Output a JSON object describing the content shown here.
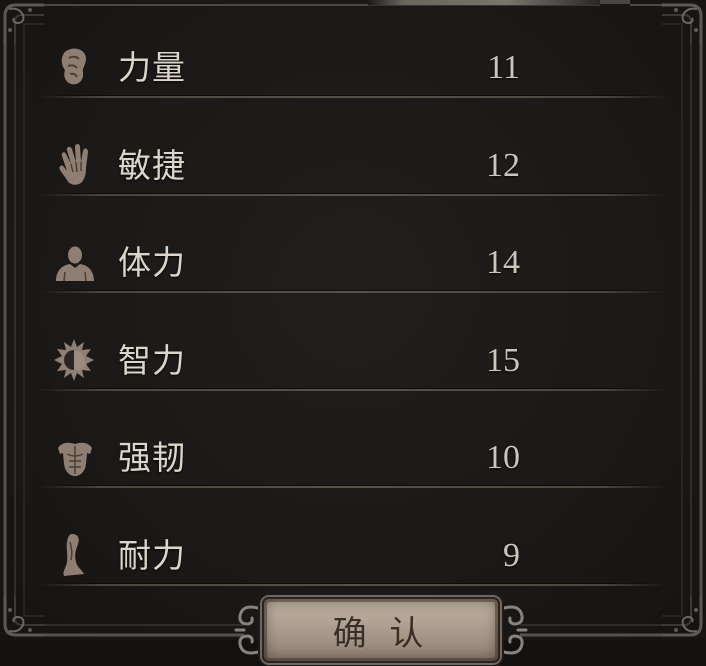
{
  "attributes": [
    {
      "label": "力量",
      "value": 11,
      "icon": "strength-icon"
    },
    {
      "label": "敏捷",
      "value": 12,
      "icon": "dexterity-icon"
    },
    {
      "label": "体力",
      "value": 14,
      "icon": "constitution-icon"
    },
    {
      "label": "智力",
      "value": 15,
      "icon": "intelligence-icon"
    },
    {
      "label": "强韧",
      "value": 10,
      "icon": "toughness-icon"
    },
    {
      "label": "耐力",
      "value": 9,
      "icon": "endurance-icon"
    }
  ],
  "confirm_button": {
    "label": "确 认"
  },
  "colors": {
    "background": "#1b1917",
    "label_text": "#dcd5cb",
    "value_text": "#cbc5bc",
    "icon_fill": "#8f7e72",
    "button_fill": "#a89a8d",
    "button_text": "#3a2f28",
    "frame": "#5a544e"
  }
}
